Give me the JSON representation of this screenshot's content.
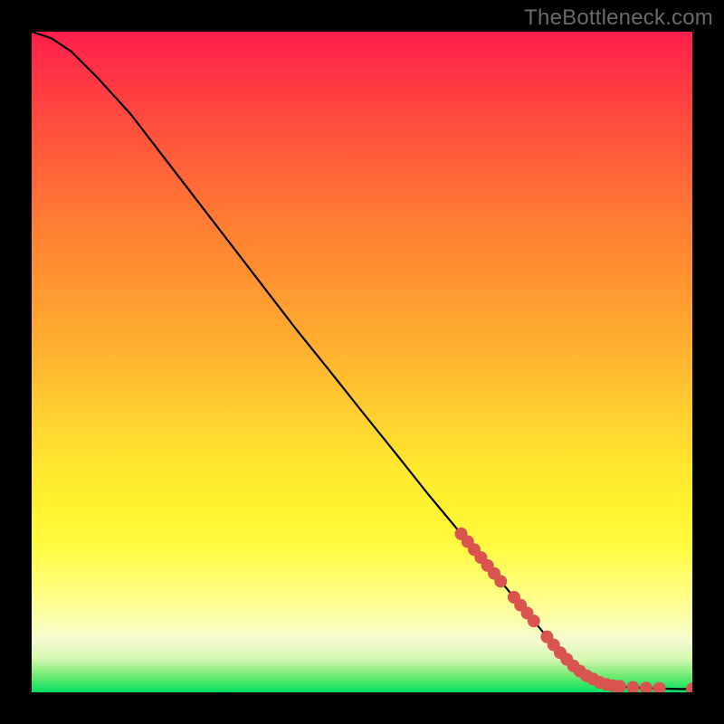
{
  "watermark": "TheBottleneck.com",
  "colors": {
    "background": "#000000",
    "marker": "#d9534f",
    "curve": "#000000"
  },
  "chart_data": {
    "type": "line",
    "title": "",
    "xlabel": "",
    "ylabel": "",
    "xlim": [
      0,
      100
    ],
    "ylim": [
      0,
      100
    ],
    "grid": false,
    "series": [
      {
        "name": "curve",
        "x": [
          0,
          3,
          6,
          10,
          15,
          20,
          25,
          30,
          35,
          40,
          45,
          50,
          55,
          60,
          65,
          70,
          75,
          80,
          82,
          84,
          86,
          88,
          90,
          92,
          94,
          96,
          98,
          100
        ],
        "y": [
          100,
          99,
          97,
          93,
          87.5,
          81,
          74.5,
          68,
          61.5,
          55,
          48.8,
          42.5,
          36.3,
          30,
          24,
          18,
          12,
          6,
          4,
          2.5,
          1.5,
          1.0,
          0.8,
          0.7,
          0.6,
          0.55,
          0.5,
          0.5
        ]
      }
    ],
    "markers": {
      "name": "highlight-points",
      "x": [
        65,
        66,
        67,
        68,
        69,
        70,
        71,
        73,
        74,
        75,
        76,
        78,
        79,
        80,
        81,
        82,
        83,
        84,
        85,
        86,
        87,
        88,
        89,
        91,
        93,
        95,
        100
      ],
      "y": [
        24.0,
        22.8,
        21.6,
        20.4,
        19.2,
        18.0,
        16.8,
        14.4,
        13.2,
        12.0,
        10.8,
        8.4,
        7.2,
        6.0,
        5.0,
        4.0,
        3.2,
        2.5,
        2.0,
        1.5,
        1.2,
        1.0,
        0.9,
        0.75,
        0.65,
        0.6,
        0.5
      ]
    }
  }
}
